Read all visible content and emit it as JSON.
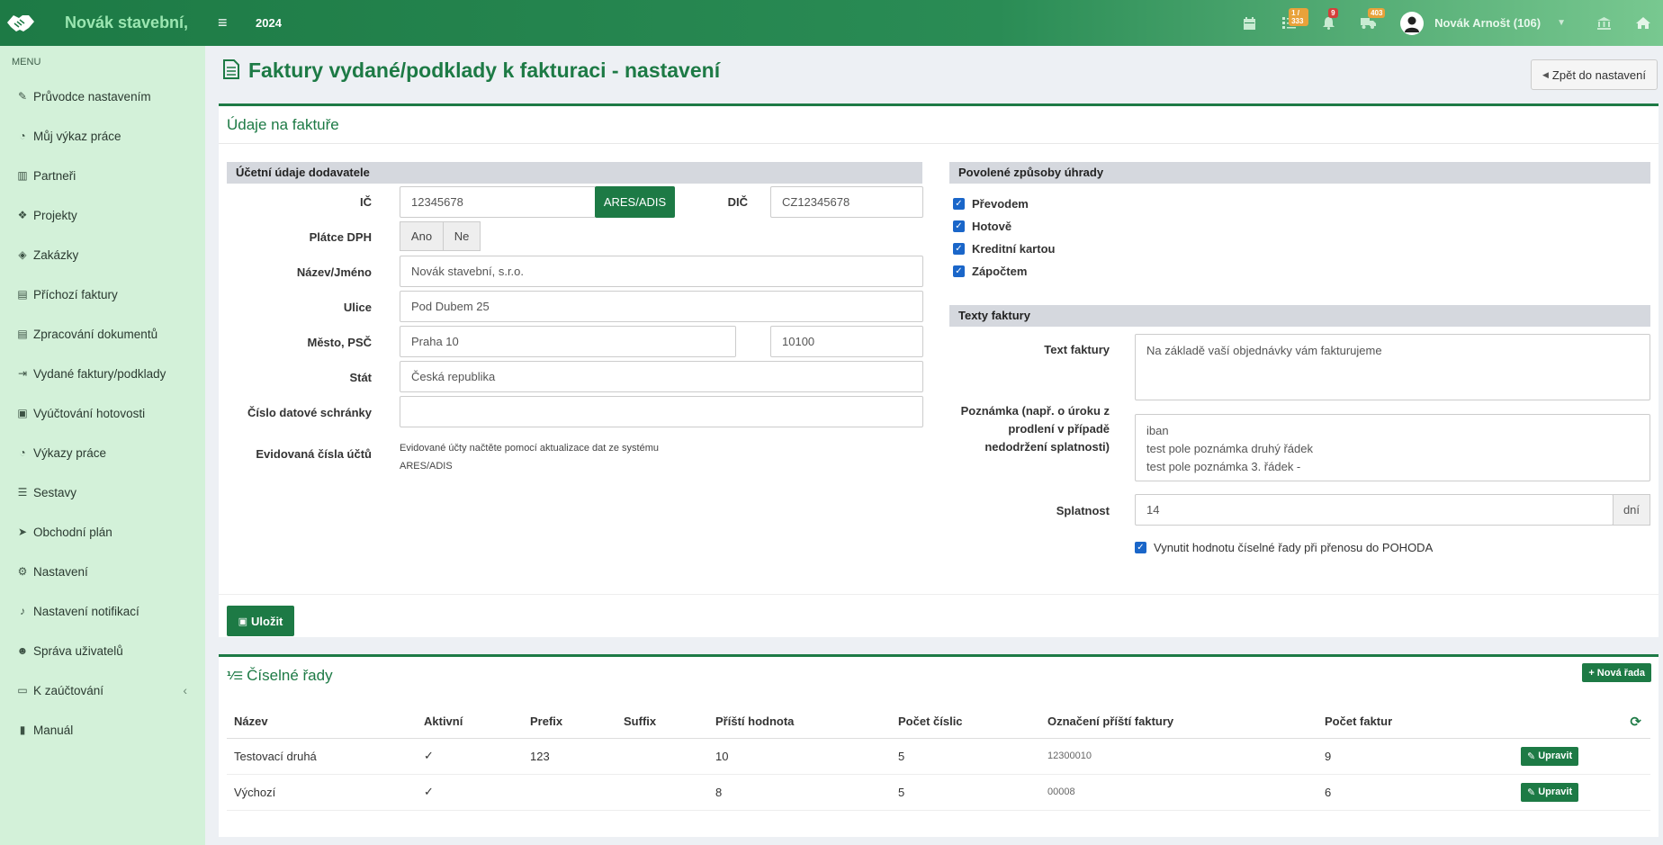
{
  "topbar": {
    "brand_name": "Novák stavební,",
    "year": "2024",
    "badges": {
      "tasks": "1 / 333",
      "notifications": "9",
      "messages": "403"
    },
    "user_name": "Novák Arnošt (106)"
  },
  "sidebar": {
    "menu_title": "MENU",
    "items": [
      {
        "label": "Průvodce nastavením",
        "icon": "wand-icon"
      },
      {
        "label": "Můj výkaz práce",
        "icon": "clock-icon"
      },
      {
        "label": "Partneři",
        "icon": "building-icon"
      },
      {
        "label": "Projekty",
        "icon": "cubes-icon"
      },
      {
        "label": "Zakázky",
        "icon": "cube-icon"
      },
      {
        "label": "Příchozí faktury",
        "icon": "file-icon"
      },
      {
        "label": "Zpracování dokumentů",
        "icon": "file-icon"
      },
      {
        "label": "Vydané faktury/podklady",
        "icon": "file-export-icon"
      },
      {
        "label": "Vyúčtování hotovosti",
        "icon": "money-icon"
      },
      {
        "label": "Výkazy práce",
        "icon": "clock-icon"
      },
      {
        "label": "Sestavy",
        "icon": "list-icon"
      },
      {
        "label": "Obchodní plán",
        "icon": "paper-plane-icon"
      },
      {
        "label": "Nastavení",
        "icon": "gears-icon"
      },
      {
        "label": "Nastavení notifikací",
        "icon": "bell-icon"
      },
      {
        "label": "Správa uživatelů",
        "icon": "users-icon"
      },
      {
        "label": "K zaúčtování",
        "icon": "folder-icon"
      },
      {
        "label": "Manuál",
        "icon": "book-icon"
      }
    ]
  },
  "page": {
    "title": "Faktury vydané/podklady k fakturaci - nastavení",
    "back_label": "Zpět do nastavení"
  },
  "invoice_panel": {
    "title": "Údaje na faktuře",
    "supplier": {
      "section_title": "Účetní údaje dodavatele",
      "ic_label": "IČ",
      "ic_value": "12345678",
      "ares_label": "ARES/ADIS",
      "dic_label": "DIČ",
      "dic_value": "CZ12345678",
      "vat_label": "Plátce DPH",
      "vat_yes": "Ano",
      "vat_no": "Ne",
      "name_label": "Název/Jméno",
      "name_value": "Novák stavební, s.r.o.",
      "street_label": "Ulice",
      "street_value": "Pod Dubem 25",
      "city_label": "Město, PSČ",
      "city_value": "Praha 10",
      "zip_value": "10100",
      "country_label": "Stát",
      "country_value": "Česká republika",
      "databox_label": "Číslo datové schránky",
      "databox_value": "",
      "accounts_label": "Evidovaná čísla účtů",
      "accounts_help": "Evidované účty načtěte pomocí aktualizace dat ze systému ARES/ADIS"
    },
    "payment": {
      "section_title": "Povolené způsoby úhrady",
      "methods": [
        {
          "label": "Převodem",
          "checked": true
        },
        {
          "label": "Hotově",
          "checked": true
        },
        {
          "label": "Kreditní kartou",
          "checked": true
        },
        {
          "label": "Zápočtem",
          "checked": true
        }
      ]
    },
    "texts": {
      "section_title": "Texty faktury",
      "text_label": "Text faktury",
      "text_value": "Na základě vaší objednávky vám fakturujeme",
      "note_label": "Poznámka (např. o úroku z prodlení v případě nedodržení splatnosti)",
      "note_lines": [
        "iban",
        "test pole poznámka druhý řádek",
        "test pole poznámka 3. řádek -"
      ],
      "due_label": "Splatnost",
      "due_value": "14",
      "due_unit": "dní",
      "pohoda_label": "Vynutit hodnotu číselné řady při přenosu do POHODA",
      "pohoda_checked": true
    },
    "save_label": "Uložit"
  },
  "series_panel": {
    "title": "Číselné řady",
    "new_label": "Nová řada",
    "columns": [
      "Název",
      "Aktivní",
      "Prefix",
      "Suffix",
      "Příští hodnota",
      "Počet číslic",
      "Označení příští faktury",
      "Počet faktur"
    ],
    "rows": [
      {
        "name": "Testovací druhá",
        "active": "✓",
        "prefix": "123",
        "suffix": "",
        "next": "10",
        "digits": "5",
        "next_label": "12300010",
        "count": "9"
      },
      {
        "name": "Výchozí",
        "active": "✓",
        "prefix": "",
        "suffix": "",
        "next": "8",
        "digits": "5",
        "next_label": "00008",
        "count": "6"
      }
    ],
    "edit_label": "Upravit"
  },
  "colors": {
    "primary": "#1d7a45",
    "sidebar_bg": "#d3f1d9",
    "badge_orange": "#e8a23a",
    "badge_red": "#d43f3a"
  }
}
